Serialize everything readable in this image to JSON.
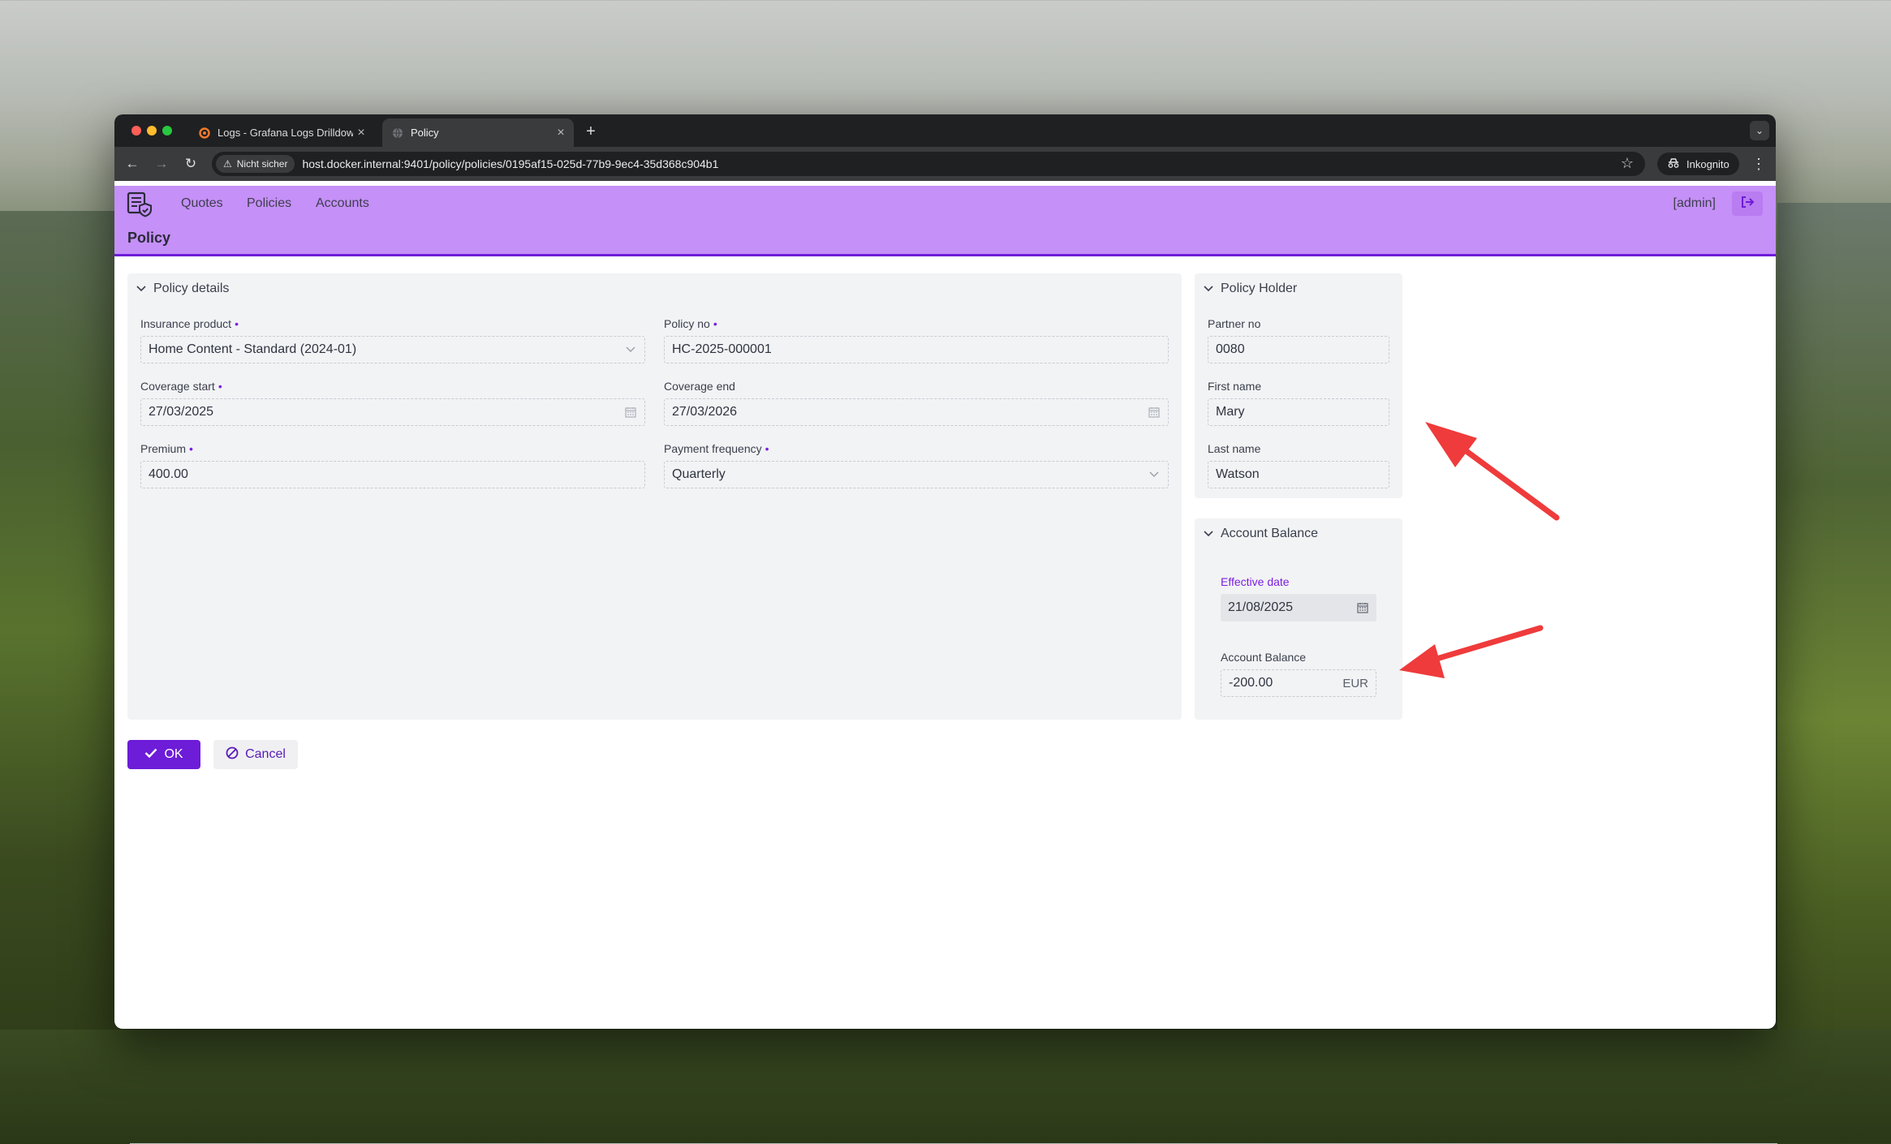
{
  "browser": {
    "tabs": [
      {
        "title": "Logs - Grafana Logs Drilldown",
        "active": false
      },
      {
        "title": "Policy",
        "active": true
      }
    ],
    "security_label": "Nicht sicher",
    "url": "host.docker.internal:9401/policy/policies/0195af15-025d-77b9-9ec4-35d368c904b1",
    "incognito_label": "Inkognito"
  },
  "app": {
    "nav": {
      "quotes": "Quotes",
      "policies": "Policies",
      "accounts": "Accounts"
    },
    "user": "[admin]",
    "page_title": "Policy",
    "accent_color": "#6d1cd8",
    "header_color": "#c590f7"
  },
  "policy_details": {
    "title": "Policy details",
    "insurance_product": {
      "label": "Insurance product",
      "value": "Home Content - Standard (2024-01)"
    },
    "policy_no": {
      "label": "Policy no",
      "value": "HC-2025-000001"
    },
    "coverage_start": {
      "label": "Coverage start",
      "value": "27/03/2025"
    },
    "coverage_end": {
      "label": "Coverage end",
      "value": "27/03/2026"
    },
    "premium": {
      "label": "Premium",
      "value": "400.00"
    },
    "payment_frequency": {
      "label": "Payment frequency",
      "value": "Quarterly"
    }
  },
  "policy_holder": {
    "title": "Policy Holder",
    "partner_no": {
      "label": "Partner no",
      "value": "0080"
    },
    "first_name": {
      "label": "First name",
      "value": "Mary"
    },
    "last_name": {
      "label": "Last name",
      "value": "Watson"
    }
  },
  "account_balance": {
    "title": "Account Balance",
    "effective_date": {
      "label": "Effective date",
      "value": "21/08/2025"
    },
    "balance": {
      "label": "Account Balance",
      "value": "-200.00",
      "currency": "EUR"
    }
  },
  "actions": {
    "ok": "OK",
    "cancel": "Cancel"
  }
}
